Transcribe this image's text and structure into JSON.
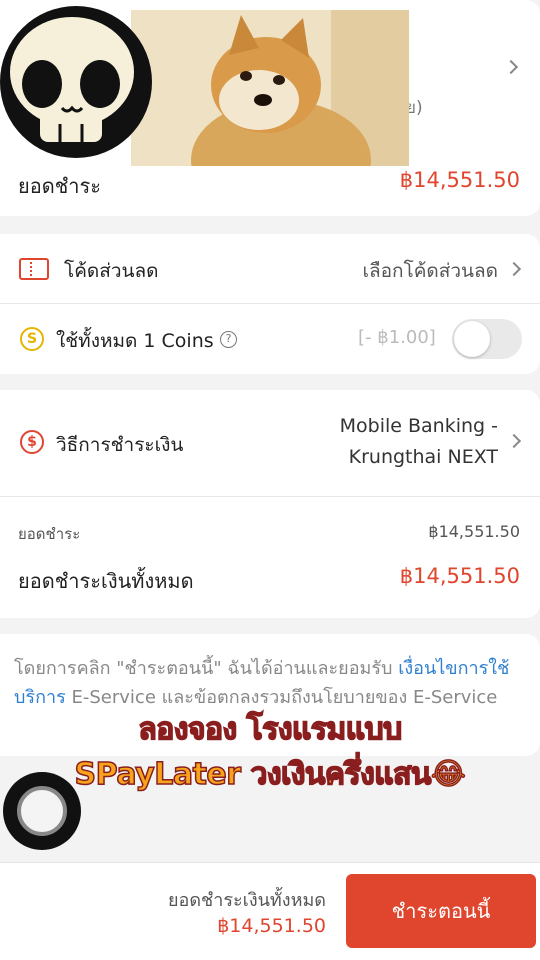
{
  "top": {
    "partial_text": "ย)",
    "total_label": "ยอดชำระ",
    "total_value": "฿14,551.50"
  },
  "discount": {
    "code_label": "โค้ดส่วนลด",
    "code_action": "เลือกโค้ดส่วนลด",
    "coins_label": "ใช้ทั้งหมด 1 Coins",
    "coins_value": "[- ฿1.00]"
  },
  "payment": {
    "method_label": "วิธีการชำระเงิน",
    "method_value_line1": "Mobile Banking -",
    "method_value_line2": "Krungthai NEXT",
    "subtotal_label": "ยอดชำระ",
    "subtotal_value": "฿14,551.50",
    "grand_label": "ยอดชำระเงินทั้งหมด",
    "grand_value": "฿14,551.50"
  },
  "terms": {
    "prefix": "โดยการคลิก \"ชำระตอนนี้\" ฉันได้อ่านและยอมรับ ",
    "link": "เงื่อนไขการใช้บริการ",
    "suffix": " E-Service และข้อตกลงรวมถึงนโยบายของ E-Service"
  },
  "overlay": {
    "caption_line1": "ลองจอง โรงแรมแบบ",
    "caption_line2": "SPayLater วงเงินครึ่งแสน😂"
  },
  "bottom": {
    "total_label": "ยอดชำระเงินทั้งหมด",
    "total_value": "฿14,551.50",
    "pay_button": "ชำระตอนนี้"
  },
  "colors": {
    "accent": "#e0452e",
    "link": "#2f7fd0",
    "caption_fill": "#f7a41d"
  }
}
